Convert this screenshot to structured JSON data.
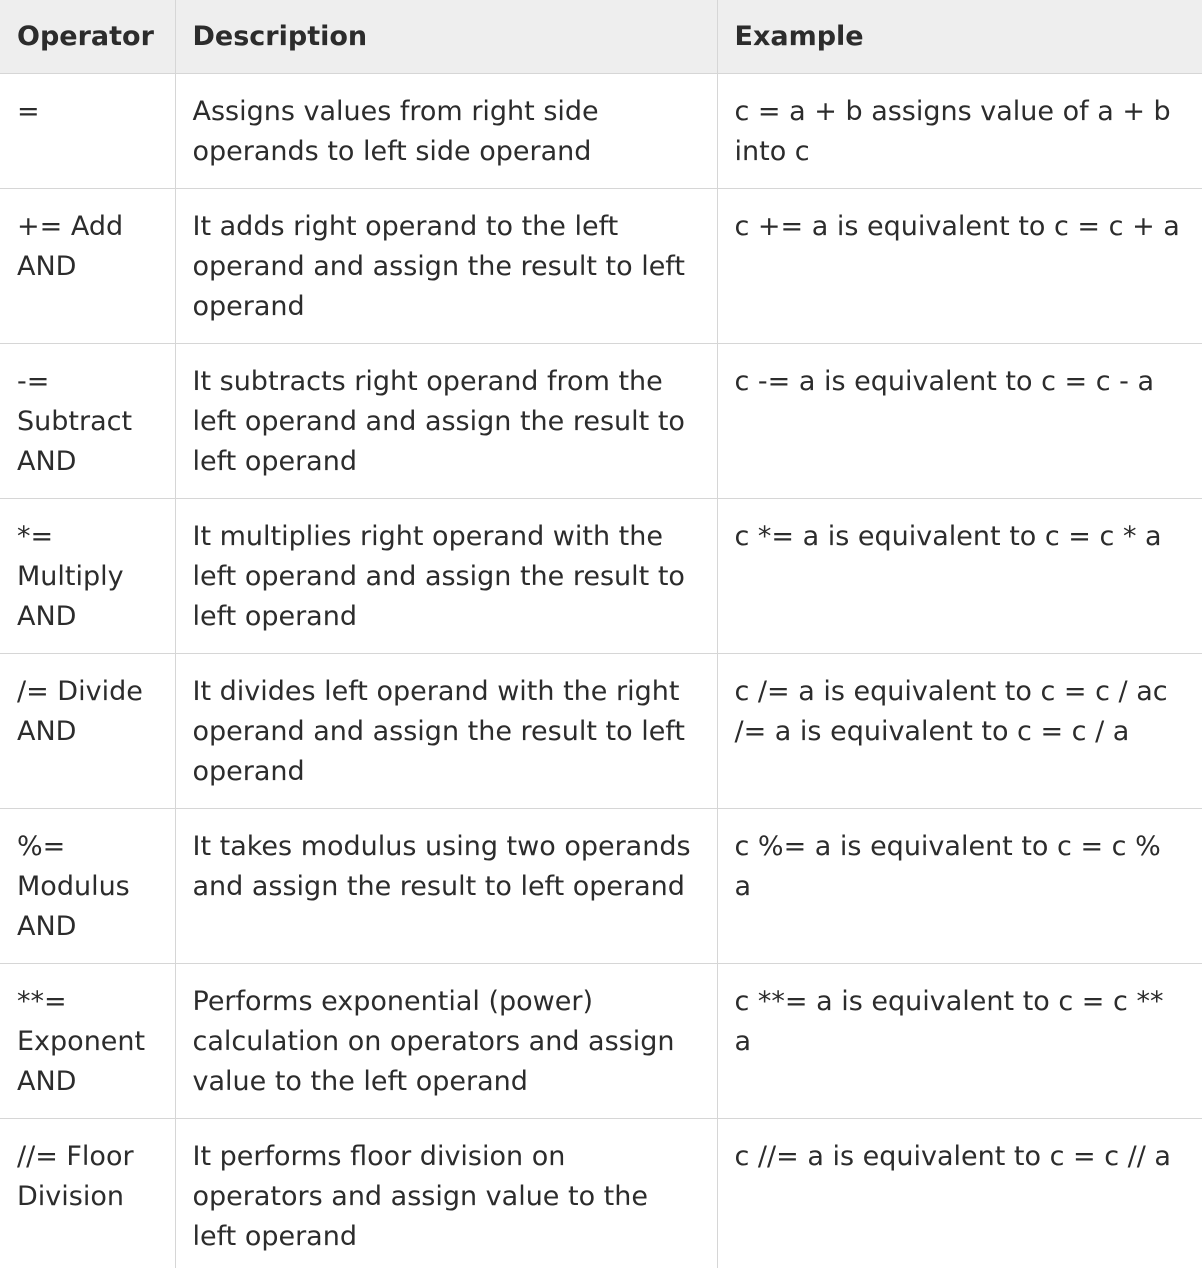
{
  "table": {
    "headers": [
      "Operator",
      "Description",
      "Example"
    ],
    "rows": [
      {
        "operator": "=",
        "description": "Assigns values from right side operands to left side operand",
        "example": "c = a + b assigns value of a + b into c"
      },
      {
        "operator": "+= Add AND",
        "description": "It adds right operand to the left operand and assign the result to left operand",
        "example": "c += a is equivalent to c = c + a"
      },
      {
        "operator": "-= Subtract AND",
        "description": "It subtracts right operand from the left operand and assign the result to left operand",
        "example": "c -= a is equivalent to c = c - a"
      },
      {
        "operator": "*= Multiply AND",
        "description": "It multiplies right operand with the left operand and assign the result to left operand",
        "example": "c *= a is equivalent to c = c * a"
      },
      {
        "operator": "/= Divide AND",
        "description": "It divides left operand with the right operand and assign the result to left operand",
        "example": "c /= a is equivalent to c = c / ac /= a is equivalent to c = c / a"
      },
      {
        "operator": "%= Modulus AND",
        "description": "It takes modulus using two operands and assign the result to left operand",
        "example": "c %= a is equivalent to c = c % a"
      },
      {
        "operator": "**= Exponent AND",
        "description": "Performs exponential (power) calculation on operators and assign value to the left operand",
        "example": "c **= a is equivalent to c = c ** a"
      },
      {
        "operator": "//= Floor Division",
        "description": "It performs floor division on operators and assign value to the left operand",
        "example": "c //= a is equivalent to c = c // a"
      }
    ]
  }
}
